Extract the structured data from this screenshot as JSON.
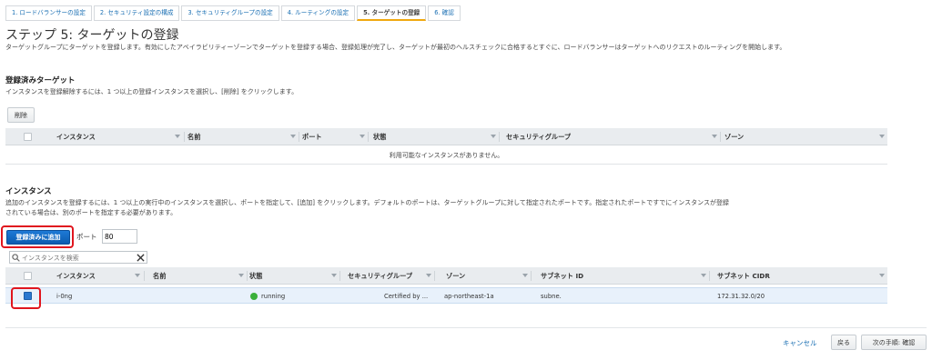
{
  "wizard": {
    "steps": [
      "1. ロードバランサーの設定",
      "2. セキュリティ設定の構成",
      "3. セキュリティグループの設定",
      "4. ルーティングの設定",
      "5. ターゲットの登録",
      "6. 確認"
    ],
    "active_index": 4
  },
  "page": {
    "title": "ステップ 5: ターゲットの登録",
    "description": "ターゲットグループにターゲットを登録します。有効にしたアベイラビリティーゾーンでターゲットを登録する場合、登録処理が完了し、ターゲットが最初のヘルスチェックに合格するとすぐに、ロードバランサーはターゲットへのリクエストのルーティングを開始します。"
  },
  "registered": {
    "heading": "登録済みターゲット",
    "description": "インスタンスを登録解除するには、1 つ以上の登録インスタンスを選択し、[削除] をクリックします。",
    "remove_button": "削除",
    "columns": [
      "インスタンス",
      "名前",
      "ポート",
      "状態",
      "セキュリティグループ",
      "ゾーン"
    ],
    "empty_message": "利用可能なインスタンスがありません。"
  },
  "instances": {
    "heading": "インスタンス",
    "description_line1": "追加のインスタンスを登録するには、1 つ以上の実行中のインスタンスを選択し、ポートを指定して、[追加] をクリックします。デフォルトのポートは、ターゲットグループに対して指定されたポートです。指定されたポートですでにインスタンスが登録",
    "description_line2": "されている場合は、別のポートを指定する必要があります。",
    "add_button": "登録済みに追加",
    "port_label": "ポート",
    "port_value": "80",
    "search_placeholder": "インスタンスを検索",
    "columns": [
      "インスタンス",
      "名前",
      "状態",
      "セキュリティグループ",
      "ゾーン",
      "サブネット ID",
      "サブネット CIDR"
    ],
    "rows": [
      {
        "instance": "i-0ng",
        "name": "",
        "state": "running",
        "security_group": "Certified by ...",
        "zone": "ap-northeast-1a",
        "subnet_id": "subne.",
        "subnet_cidr": "172.31.32.0/20",
        "selected": true
      }
    ]
  },
  "footer": {
    "cancel": "キャンセル",
    "back": "戻る",
    "next": "次の手順: 確認"
  },
  "colors": {
    "primary": "#0c5cb0",
    "link": "#1a6fb3",
    "highlight": "#e0161e",
    "running": "#3ab03a",
    "selected_row": "#e8f1fb"
  }
}
